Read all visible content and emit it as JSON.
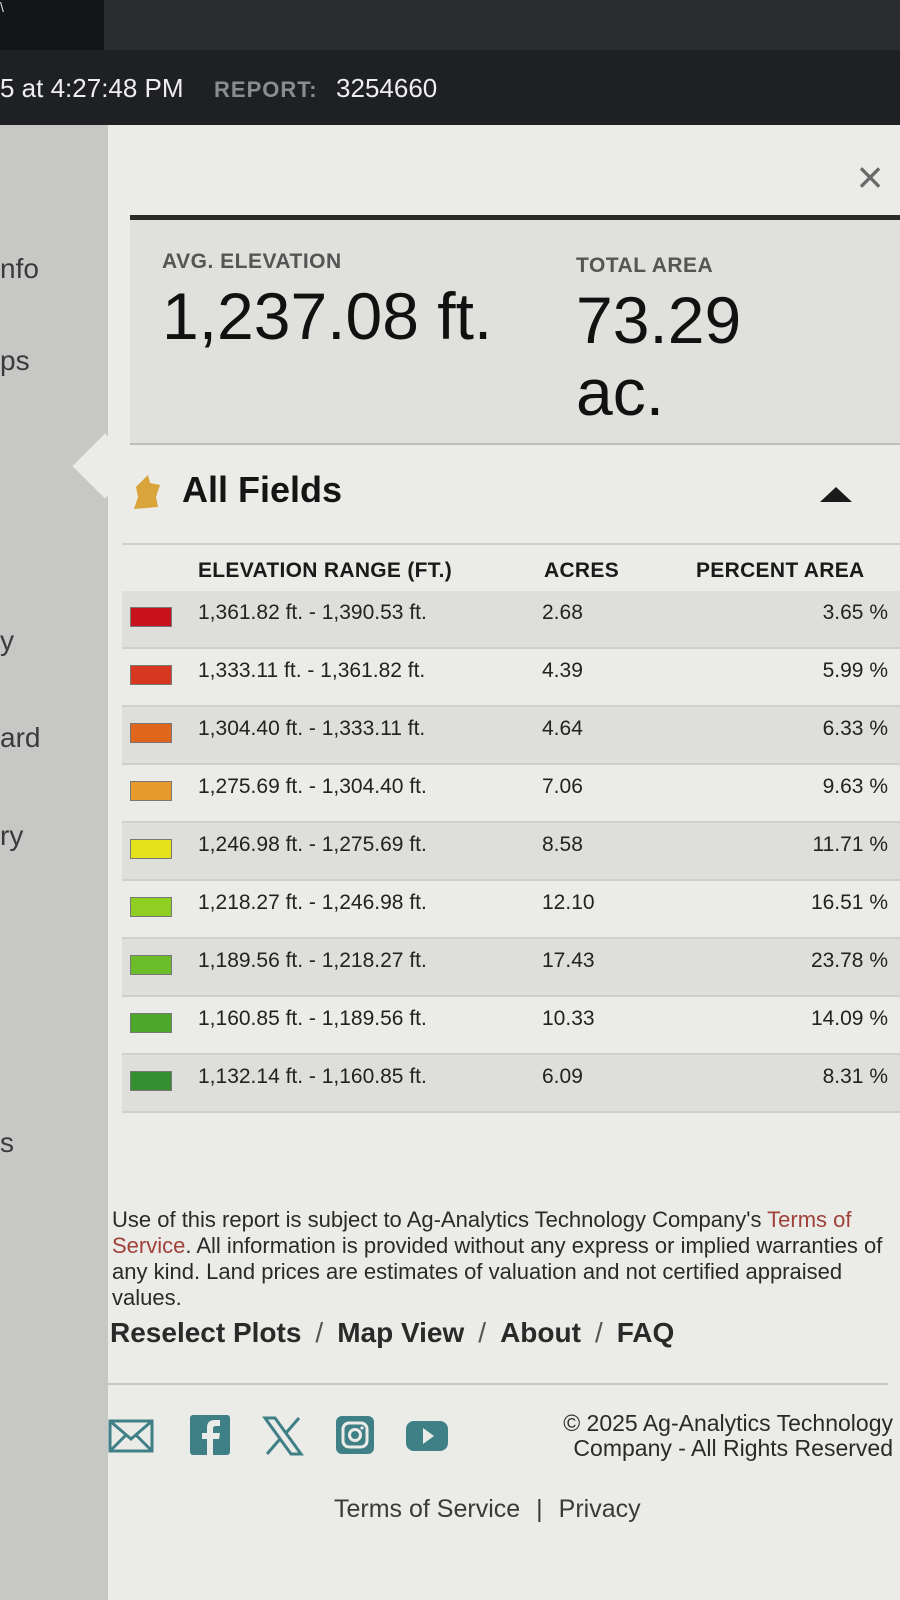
{
  "header": {
    "corner_glyph": "\\",
    "timestamp": "5 at 4:27:48 PM",
    "report_label": "REPORT:",
    "report_number": "3254660"
  },
  "sidebar": {
    "fragments": [
      "nfo",
      "ps",
      "y",
      "ard",
      "ry",
      "s"
    ]
  },
  "panel": {
    "close_label": "×",
    "summary": {
      "avg_elevation_label": "AVG. ELEVATION",
      "avg_elevation_value": "1,237.08 ft.",
      "total_area_label": "TOTAL AREA",
      "total_area_value_line1": "73.29",
      "total_area_value_line2": "ac."
    },
    "fields_title": "All Fields",
    "table": {
      "headers": {
        "range": "ELEVATION RANGE (FT.)",
        "acres": "ACRES",
        "percent": "PERCENT AREA"
      },
      "rows": [
        {
          "range": "1,361.82 ft. - 1,390.53 ft.",
          "acres": "2.68",
          "percent": "3.65 %",
          "color": "#c8121b"
        },
        {
          "range": "1,333.11 ft. - 1,361.82 ft.",
          "acres": "4.39",
          "percent": "5.99 %",
          "color": "#d8371f"
        },
        {
          "range": "1,304.40 ft. - 1,333.11 ft.",
          "acres": "4.64",
          "percent": "6.33 %",
          "color": "#e0661e"
        },
        {
          "range": "1,275.69 ft. - 1,304.40 ft.",
          "acres": "7.06",
          "percent": "9.63 %",
          "color": "#e79a2c"
        },
        {
          "range": "1,246.98 ft. - 1,275.69 ft.",
          "acres": "8.58",
          "percent": "11.71 %",
          "color": "#e4e21c"
        },
        {
          "range": "1,218.27 ft. - 1,246.98 ft.",
          "acres": "12.10",
          "percent": "16.51 %",
          "color": "#8fcf22"
        },
        {
          "range": "1,189.56 ft. - 1,218.27 ft.",
          "acres": "17.43",
          "percent": "23.78 %",
          "color": "#6bbd2a"
        },
        {
          "range": "1,160.85 ft. - 1,189.56 ft.",
          "acres": "10.33",
          "percent": "14.09 %",
          "color": "#4da82c"
        },
        {
          "range": "1,132.14 ft. - 1,160.85 ft.",
          "acres": "6.09",
          "percent": "8.31 %",
          "color": "#338f30"
        }
      ]
    },
    "disclaimer": {
      "part1": "Use of this report is subject to Ag-Analytics Technology Company's",
      "tos_link": "Terms of Service",
      "part2": ". All information is provided without any express or implied warranties of any kind. Land prices are estimates of valuation and not certified appraised values."
    },
    "footer_nav": [
      "Reselect Plots",
      "Map View",
      "About",
      "FAQ"
    ],
    "nav_separator": "/",
    "socials": [
      "mail-icon",
      "facebook-icon",
      "x-icon",
      "instagram-icon",
      "youtube-icon"
    ],
    "copyright_line1": "© 2025 Ag-Analytics Technology",
    "copyright_line2": "Company - All Rights Reserved",
    "legal_links": [
      "Terms of Service",
      "Privacy"
    ],
    "legal_separator": "|",
    "colors": {
      "accent_link": "#a0413a",
      "social_teal": "#3f7f86",
      "panel_bg": "#ebebe8",
      "header_bg": "#1e2023"
    }
  }
}
